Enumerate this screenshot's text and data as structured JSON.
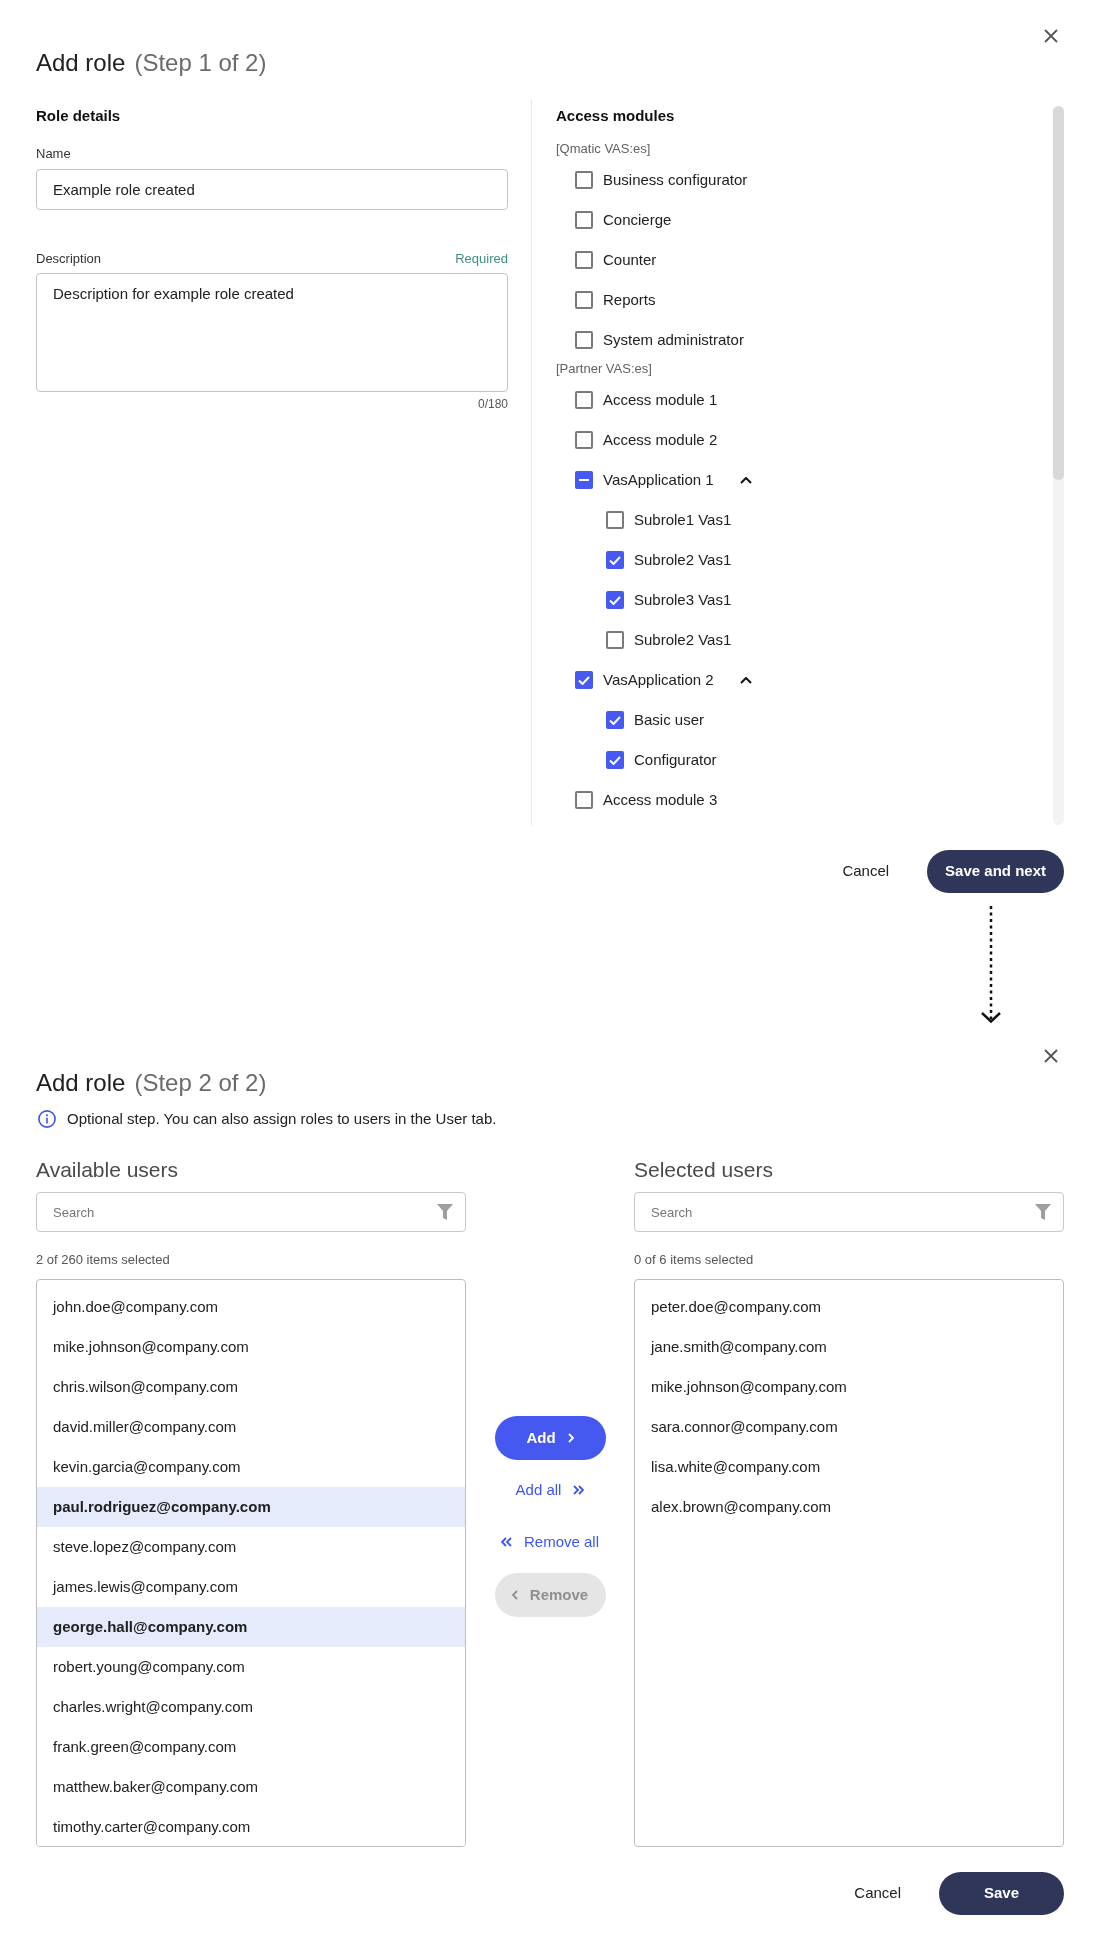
{
  "step1": {
    "header": {
      "title": "Add role",
      "step": "(Step 1 of 2)"
    },
    "role_details": {
      "heading": "Role details",
      "name_field": {
        "label": "Name",
        "value": "Example role created"
      },
      "description_field": {
        "label": "Description",
        "required_note": "Required",
        "value": "Description for example role created",
        "counter": "0/180"
      }
    },
    "access_modules": {
      "heading": "Access modules",
      "groups": [
        {
          "label": "[Qmatic VAS:es]",
          "items": [
            {
              "label": "Business configurator",
              "checked": false
            },
            {
              "label": "Concierge",
              "checked": false
            },
            {
              "label": "Counter",
              "checked": false
            },
            {
              "label": "Reports",
              "checked": false
            },
            {
              "label": "System administrator",
              "checked": false
            }
          ]
        },
        {
          "label": "[Partner VAS:es]",
          "items": [
            {
              "label": "Access module 1",
              "checked": false
            },
            {
              "label": "Access module 2",
              "checked": false
            },
            {
              "label": "VasApplication 1",
              "indeterminate": true,
              "expanded": true,
              "children": [
                {
                  "label": "Subrole1 Vas1",
                  "checked": false
                },
                {
                  "label": "Subrole2 Vas1",
                  "checked": true
                },
                {
                  "label": "Subrole3 Vas1",
                  "checked": true
                },
                {
                  "label": "Subrole2 Vas1",
                  "checked": false
                }
              ]
            },
            {
              "label": "VasApplication 2",
              "checked": true,
              "expanded": true,
              "children": [
                {
                  "label": "Basic user",
                  "checked": true
                },
                {
                  "label": "Configurator",
                  "checked": true
                }
              ]
            },
            {
              "label": "Access module 3",
              "checked": false
            }
          ]
        }
      ]
    },
    "buttons": [
      {
        "label": "Cancel",
        "kind": "text"
      },
      {
        "label": "Save and next",
        "kind": "primary"
      }
    ]
  },
  "step2": {
    "header": {
      "title": "Add role",
      "step": "(Step 2 of 2)"
    },
    "info": "Optional step. You can also assign roles to users in the User tab.",
    "available_users": {
      "heading": "Available users",
      "search": {
        "placeholder": "Search"
      },
      "count": "2 of 260 items selected",
      "items": [
        {
          "email": "john.doe@company.com",
          "selected": false
        },
        {
          "email": "mike.johnson@company.com",
          "selected": false
        },
        {
          "email": "chris.wilson@company.com",
          "selected": false
        },
        {
          "email": "david.miller@company.com",
          "selected": false
        },
        {
          "email": "kevin.garcia@company.com",
          "selected": false
        },
        {
          "email": "paul.rodriguez@company.com",
          "selected": true
        },
        {
          "email": "steve.lopez@company.com",
          "selected": false
        },
        {
          "email": "james.lewis@company.com",
          "selected": false
        },
        {
          "email": "george.hall@company.com",
          "selected": true
        },
        {
          "email": "robert.young@company.com",
          "selected": false
        },
        {
          "email": "charles.wright@company.com",
          "selected": false
        },
        {
          "email": "frank.green@company.com",
          "selected": false
        },
        {
          "email": "matthew.baker@company.com",
          "selected": false
        },
        {
          "email": "timothy.carter@company.com",
          "selected": false
        }
      ]
    },
    "transfer_buttons": [
      {
        "label": "Add",
        "kind": "filled",
        "disabled": false
      },
      {
        "label": "Add all",
        "kind": "link",
        "disabled": false
      },
      {
        "label": "Remove all",
        "kind": "link",
        "disabled": false
      },
      {
        "label": "Remove",
        "kind": "filled",
        "disabled": true
      }
    ],
    "selected_users": {
      "heading": "Selected users",
      "search": {
        "placeholder": "Search"
      },
      "count": "0 of 6 items selected",
      "items": [
        {
          "email": "peter.doe@company.com",
          "selected": false
        },
        {
          "email": "jane.smith@company.com",
          "selected": false
        },
        {
          "email": "mike.johnson@company.com",
          "selected": false
        },
        {
          "email": "sara.connor@company.com",
          "selected": false
        },
        {
          "email": "lisa.white@company.com",
          "selected": false
        },
        {
          "email": "alex.brown@company.com",
          "selected": false
        }
      ]
    },
    "buttons": [
      {
        "label": "Cancel",
        "kind": "text"
      },
      {
        "label": "Save",
        "kind": "primary"
      }
    ]
  }
}
